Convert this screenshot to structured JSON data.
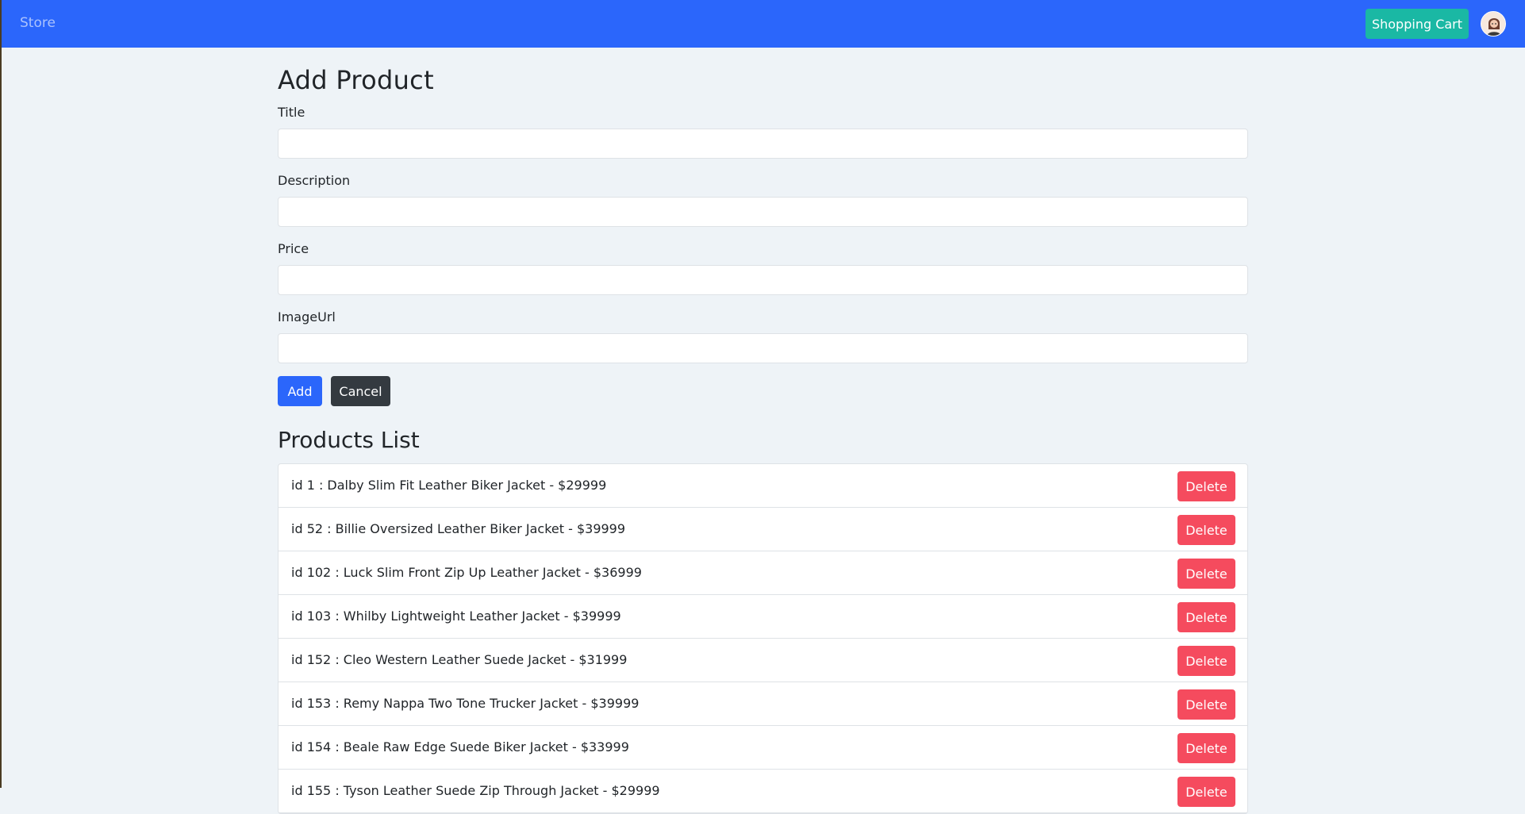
{
  "navbar": {
    "brand": "Store",
    "cart_label": "Shopping Cart",
    "avatar_icon": "user-avatar-icon",
    "bg_color": "#2b66fb"
  },
  "form": {
    "title": "Add Product",
    "fields": [
      {
        "label": "Title",
        "value": ""
      },
      {
        "label": "Description",
        "value": ""
      },
      {
        "label": "Price",
        "value": ""
      },
      {
        "label": "ImageUrl",
        "value": ""
      }
    ],
    "add_label": "Add",
    "cancel_label": "Cancel"
  },
  "products": {
    "title": "Products List",
    "delete_label": "Delete",
    "items": [
      "id 1 : Dalby Slim Fit Leather Biker Jacket - $29999",
      "id 52 : Billie Oversized Leather Biker Jacket - $39999",
      "id 102 : Luck Slim Front Zip Up Leather Jacket - $36999",
      "id 103 : Whilby Lightweight Leather Jacket - $39999",
      "id 152 : Cleo Western Leather Suede Jacket - $31999",
      "id 153 : Remy Nappa Two Tone Trucker Jacket - $39999",
      "id 154 : Beale Raw Edge Suede Biker Jacket - $33999",
      "id 155 : Tyson Leather Suede Zip Through Jacket - $29999"
    ]
  }
}
